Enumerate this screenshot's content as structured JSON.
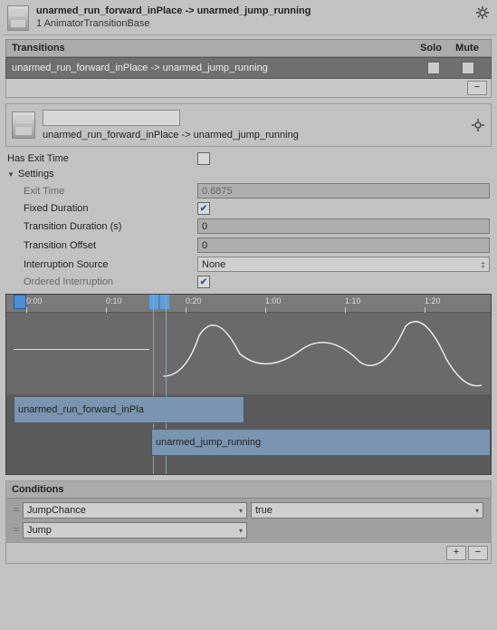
{
  "header": {
    "title": "unarmed_run_forward_inPlace -> unarmed_jump_running",
    "subtitle": "1 AnimatorTransitionBase"
  },
  "transitions": {
    "header_label": "Transitions",
    "solo_label": "Solo",
    "mute_label": "Mute",
    "rows": [
      {
        "name": "unarmed_run_forward_inPlace -> unarmed_jump_running",
        "solo": false,
        "mute": false
      }
    ]
  },
  "selected": {
    "name_value": "",
    "name_display": "unarmed_run_forward_inPlace -> unarmed_jump_running"
  },
  "props": {
    "has_exit_time_label": "Has Exit Time",
    "has_exit_time": false,
    "settings_label": "Settings",
    "exit_time_label": "Exit Time",
    "exit_time": "0.6875",
    "fixed_duration_label": "Fixed Duration",
    "fixed_duration": true,
    "transition_duration_label": "Transition Duration (s)",
    "transition_duration": "0",
    "transition_offset_label": "Transition Offset",
    "transition_offset": "0",
    "interruption_source_label": "Interruption Source",
    "interruption_source": "None",
    "ordered_interruption_label": "Ordered Interruption",
    "ordered_interruption": true
  },
  "timeline": {
    "ticks": [
      "0:00",
      "0:10",
      "0:20",
      "1:00",
      "1:10",
      "1:20"
    ],
    "clip1_label": "unarmed_run_forward_inPla",
    "clip2_label": "unarmed_jump_running"
  },
  "conditions": {
    "header": "Conditions",
    "rows": [
      {
        "param": "JumpChance",
        "value": "true"
      },
      {
        "param": "Jump",
        "value": ""
      }
    ]
  },
  "glyphs": {
    "minus": "−",
    "plus": "+",
    "check": "✔",
    "drag": "="
  }
}
